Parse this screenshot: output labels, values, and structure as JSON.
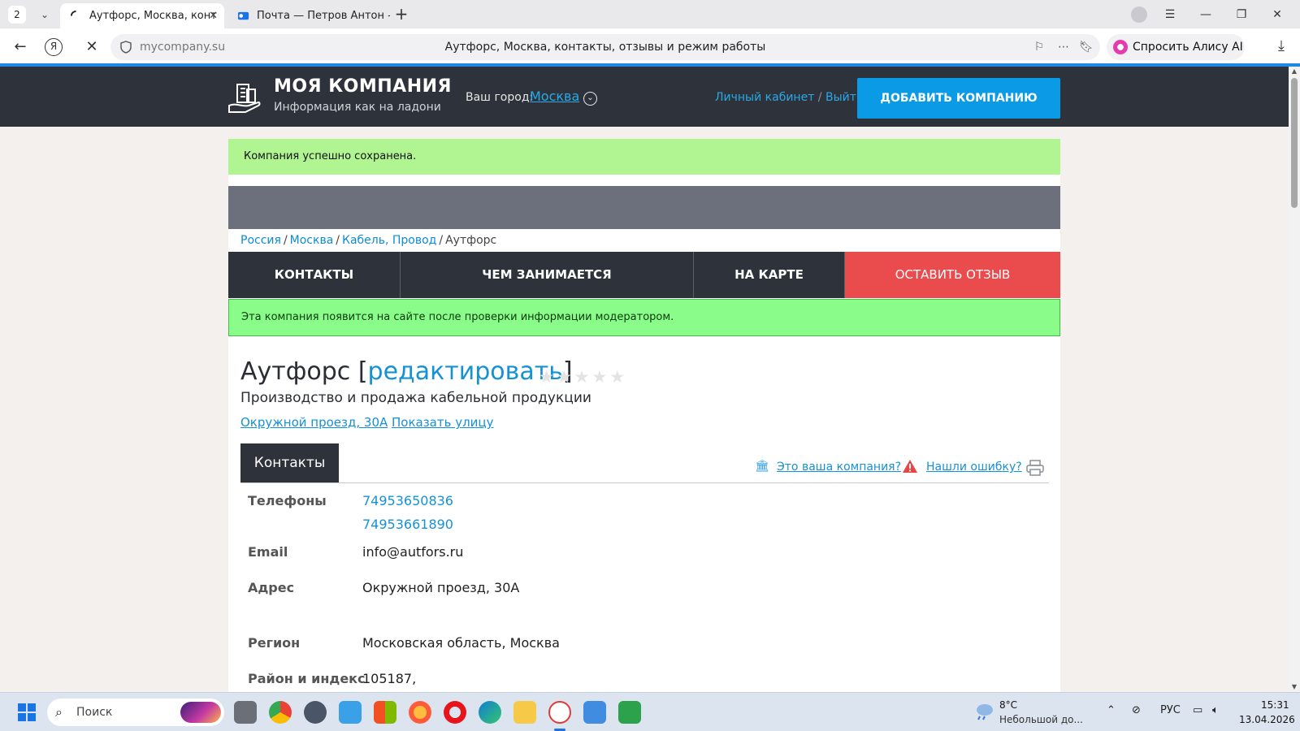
{
  "browser": {
    "tab_count": "2",
    "tabs": [
      {
        "title": "Аутфорс, Москва, конт",
        "active": true
      },
      {
        "title": "Почта — Петров Антон —",
        "active": false
      }
    ],
    "address": {
      "domain": "mycompany.su",
      "page_title": "Аутфорс, Москва, контакты, отзывы и режим работы"
    },
    "alice_label": "Спросить Алису AI"
  },
  "site": {
    "logo_title": "МОЯ КОМПАНИЯ",
    "logo_subtitle": "Информация как на ладони",
    "city_label": "Ваш город:",
    "city": "Москва",
    "cabinet": "Личный кабинет",
    "logout": "Выйти",
    "add_company": "ДОБАВИТЬ КОМПАНИЮ"
  },
  "notice_saved": "Компания успешно сохранена.",
  "breadcrumb": [
    "Россия",
    "Москва",
    "Кабель, Провод",
    "Аутфорс"
  ],
  "menu": [
    "КОНТАКТЫ",
    "ЧЕМ ЗАНИМАЕТСЯ",
    "НА КАРТЕ",
    "ОСТАВИТЬ ОТЗЫВ"
  ],
  "notice_moderation": "Эта компания появится на сайте после проверки информации модератором.",
  "company": {
    "name": "Аутфорс",
    "edit_label": "редактировать",
    "rating_stars": 0,
    "rating_max": 5,
    "description": "Производство и продажа кабельной продукции",
    "address_link": "Окружной проезд, 30А",
    "show_street": "Показать улицу"
  },
  "contacts": {
    "tab_label": "Контакты",
    "your_company": "Это ваша компания?",
    "found_error": "Нашли ошибку?",
    "rows": [
      {
        "label": "Телефоны",
        "values": [
          "74953650836",
          "74953661890"
        ]
      },
      {
        "label": "Email",
        "values": [
          "info@autfors.ru"
        ]
      },
      {
        "label": "Адрес",
        "values": [
          "Окружной проезд, 30А"
        ]
      },
      {
        "label": "Регион",
        "values": [
          "Московская область, Москва"
        ]
      },
      {
        "label": "Район и индекс",
        "values": [
          "105187,"
        ]
      }
    ]
  },
  "taskbar": {
    "search_placeholder": "Поиск",
    "weather_temp": "8°C",
    "weather_desc": "Небольшой до...",
    "language": "РУС",
    "time": "15:31",
    "date": "13.04.2026"
  },
  "colors": {
    "header_bg": "#2e323a",
    "accent_blue": "#0b9be6",
    "review_red": "#ea4b4d",
    "success_green": "#b0f592",
    "moderation_green": "#8afc8a"
  }
}
